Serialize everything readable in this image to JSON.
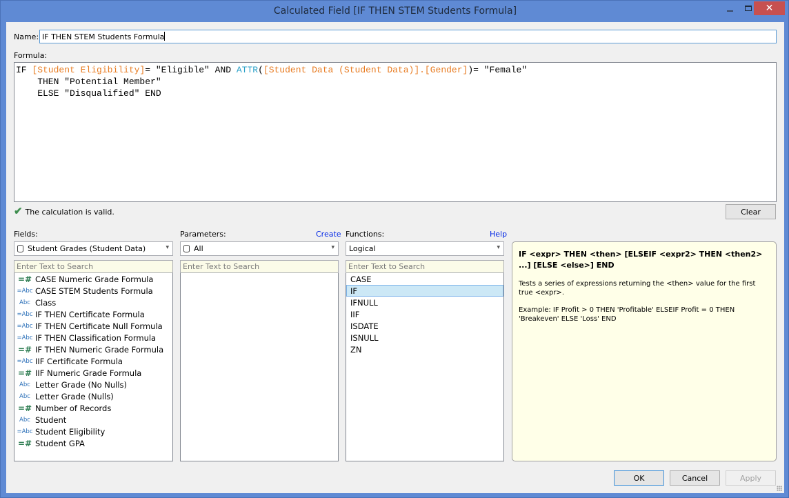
{
  "window": {
    "title": "Calculated Field [IF THEN STEM Students Formula]",
    "close_symbol": "✕"
  },
  "name_label": "Name:",
  "name_value": "IF THEN STEM Students Formula",
  "formula_label": "Formula:",
  "formula": {
    "line1": {
      "kw_if": "IF ",
      "field1": "[Student Eligibility]",
      "op1": "= \"Eligible\" AND ",
      "fn": "ATTR",
      "paren_open": "(",
      "field2": "[Student Data (Student Data)].[Gender]",
      "op2": ")= \"Female\""
    },
    "line2": "    THEN \"Potential Member\"",
    "line3": "    ELSE \"Disqualified\" END"
  },
  "status": {
    "icon": "check-icon",
    "text": "The calculation is valid.",
    "color": "#3e8e4e"
  },
  "clear_label": "Clear",
  "fields": {
    "label": "Fields:",
    "source": "Student Grades (Student Data)",
    "search_placeholder": "Enter Text to Search",
    "items": [
      {
        "type": "=#",
        "kind": "num",
        "label": "CASE Numeric Grade Formula"
      },
      {
        "type": "=Abc",
        "kind": "str",
        "label": "CASE STEM Students Formula"
      },
      {
        "type": "Abc",
        "kind": "str",
        "label": "Class"
      },
      {
        "type": "=Abc",
        "kind": "str",
        "label": "IF THEN Certificate Formula"
      },
      {
        "type": "=Abc",
        "kind": "str",
        "label": "IF THEN Certificate Null Formula"
      },
      {
        "type": "=Abc",
        "kind": "str",
        "label": "IF THEN Classification Formula"
      },
      {
        "type": "=#",
        "kind": "num",
        "label": "IF THEN Numeric Grade Formula"
      },
      {
        "type": "=Abc",
        "kind": "str",
        "label": "IIF Certificate Formula"
      },
      {
        "type": "=#",
        "kind": "num",
        "label": "IIF Numeric Grade Formula"
      },
      {
        "type": "Abc",
        "kind": "str",
        "label": "Letter Grade (No Nulls)"
      },
      {
        "type": "Abc",
        "kind": "str",
        "label": "Letter Grade (Nulls)"
      },
      {
        "type": "=#",
        "kind": "num",
        "label": "Number of Records"
      },
      {
        "type": "Abc",
        "kind": "str",
        "label": "Student"
      },
      {
        "type": "=Abc",
        "kind": "str",
        "label": "Student Eligibility"
      },
      {
        "type": "=#",
        "kind": "num",
        "label": "Student GPA"
      }
    ]
  },
  "parameters": {
    "label": "Parameters:",
    "create_link": "Create",
    "source": "All",
    "search_placeholder": "Enter Text to Search",
    "items": []
  },
  "functions": {
    "label": "Functions:",
    "help_link": "Help",
    "category": "Logical",
    "search_placeholder": "Enter Text to Search",
    "items": [
      "CASE",
      "IF",
      "IFNULL",
      "IIF",
      "ISDATE",
      "ISNULL",
      "ZN"
    ],
    "selected": "IF"
  },
  "help_panel": {
    "signature": "IF <expr> THEN <then> [ELSEIF <expr2> THEN <then2> ...] [ELSE <else>] END",
    "description": "Tests a series of expressions returning the <then> value for the first true <expr>.",
    "example": "Example: IF Profit > 0 THEN 'Profitable' ELSEIF Profit = 0 THEN 'Breakeven' ELSE 'Loss' END"
  },
  "buttons": {
    "ok": "OK",
    "cancel": "Cancel",
    "apply": "Apply"
  }
}
